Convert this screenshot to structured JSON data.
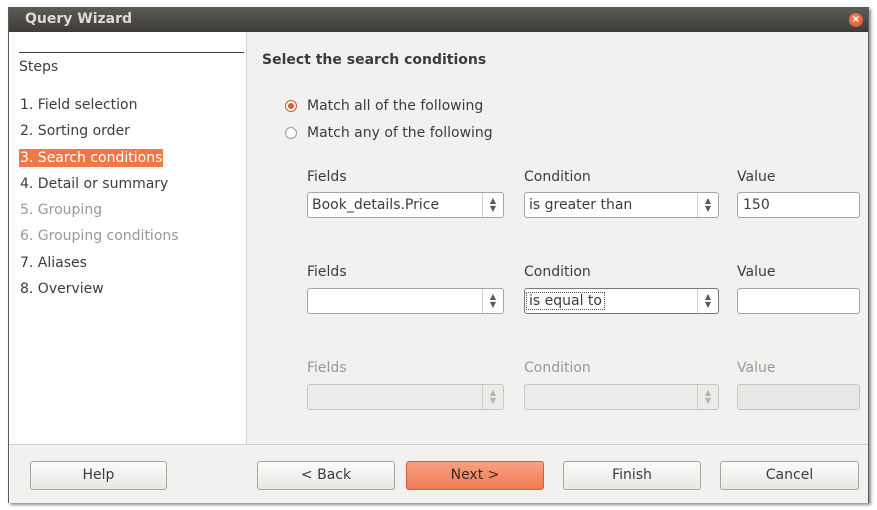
{
  "window": {
    "title": "Query Wizard"
  },
  "sidebar": {
    "title": "Steps",
    "items": [
      {
        "label": "1. Field selection",
        "state": "normal"
      },
      {
        "label": "2. Sorting order",
        "state": "normal"
      },
      {
        "label": "3. Search conditions",
        "state": "active"
      },
      {
        "label": "4. Detail or summary",
        "state": "normal"
      },
      {
        "label": "5. Grouping",
        "state": "disabled"
      },
      {
        "label": "6. Grouping conditions",
        "state": "disabled"
      },
      {
        "label": "7. Aliases",
        "state": "normal"
      },
      {
        "label": "8. Overview",
        "state": "normal"
      }
    ]
  },
  "main": {
    "heading": "Select the search conditions",
    "match_all": "Match all of the following",
    "match_any": "Match any of the following",
    "match_selected": "all",
    "rows": [
      {
        "fields_label": "Fields",
        "condition_label": "Condition",
        "value_label": "Value",
        "field": "Book_details.Price",
        "condition": "is greater than",
        "value": "150",
        "enabled": true
      },
      {
        "fields_label": "Fields",
        "condition_label": "Condition",
        "value_label": "Value",
        "field": "",
        "condition": "is equal to",
        "value": "",
        "enabled": true
      },
      {
        "fields_label": "Fields",
        "condition_label": "Condition",
        "value_label": "Value",
        "field": "",
        "condition": "",
        "value": "",
        "enabled": false
      }
    ]
  },
  "buttons": {
    "help": "Help",
    "back": "< Back",
    "next": "Next >",
    "finish": "Finish",
    "cancel": "Cancel"
  },
  "colors": {
    "accent": "#f07746",
    "titlebar": "#3d3c38",
    "window_bg": "#f2f1f0"
  }
}
